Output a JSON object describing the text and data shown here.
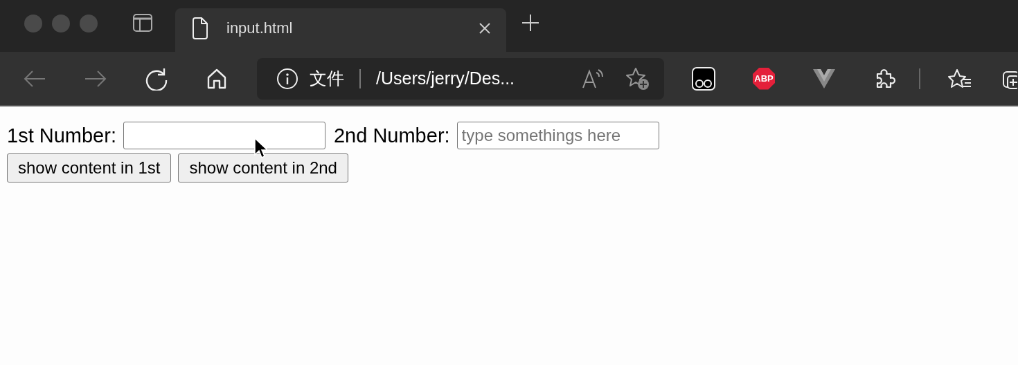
{
  "browser": {
    "tabs": [
      {
        "title": "input.html",
        "selected": true
      }
    ],
    "nav": {
      "back_disabled": true,
      "forward_disabled": true
    },
    "address_bar": {
      "security_label": "文件",
      "url": "/Users/jerry/Des..."
    },
    "abp_label": "ABP"
  },
  "page": {
    "fields": [
      {
        "label": "1st Number:"
      },
      {
        "label": "2nd Number:",
        "placeholder": "type somethings here"
      }
    ],
    "buttons": [
      "show content in 1st",
      "show content in 2nd"
    ]
  }
}
